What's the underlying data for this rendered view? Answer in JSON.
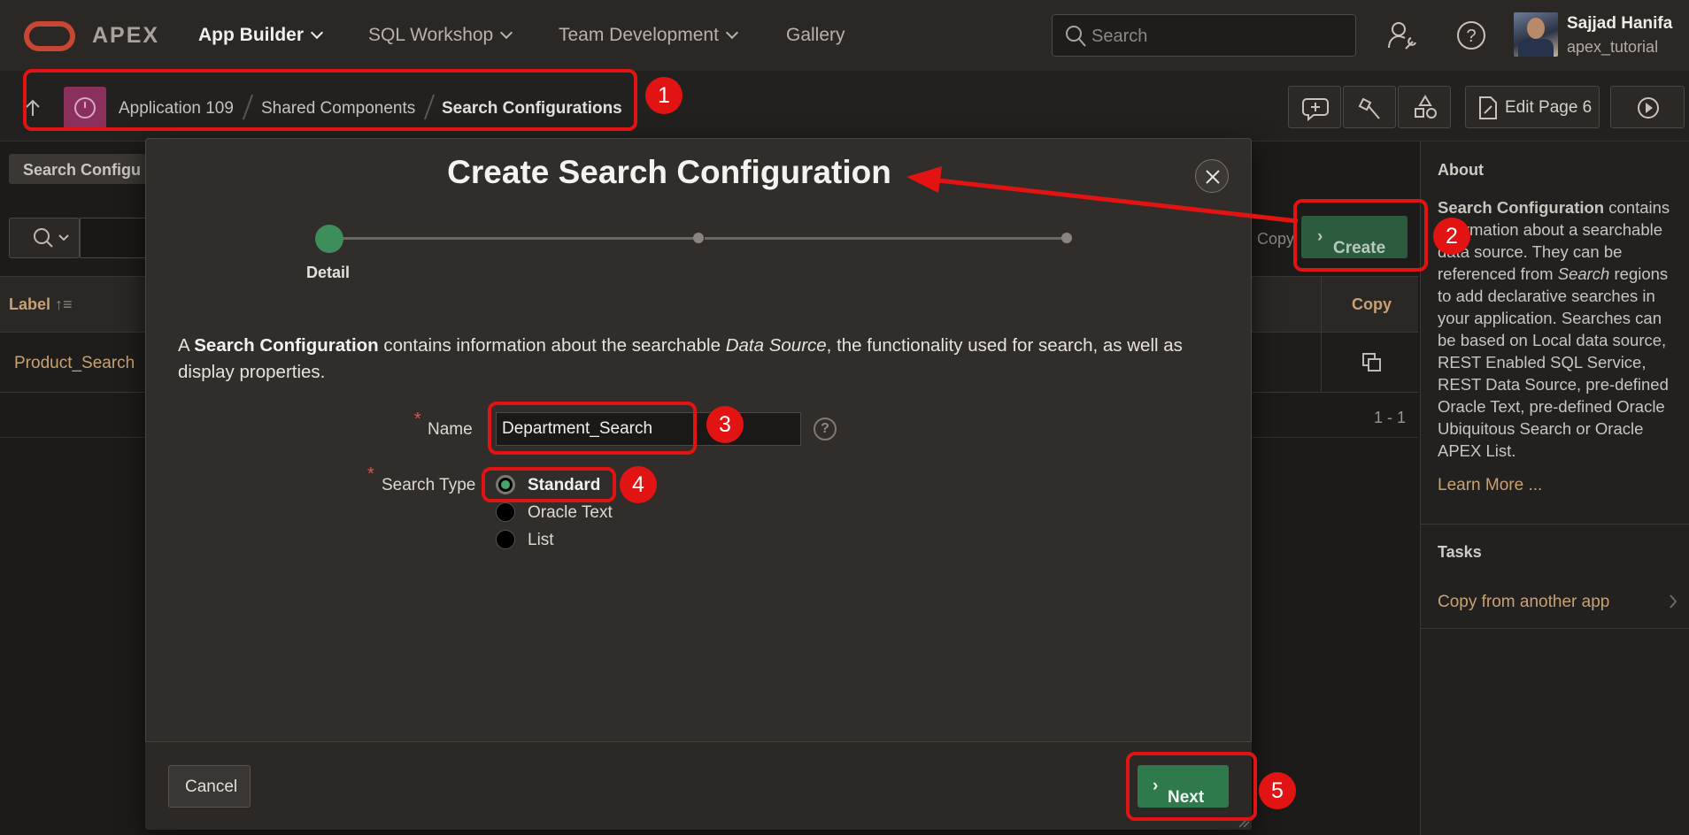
{
  "topbar": {
    "brand": "APEX",
    "nav": [
      {
        "label": "App Builder",
        "active": true
      },
      {
        "label": "SQL Workshop",
        "active": false
      },
      {
        "label": "Team Development",
        "active": false
      },
      {
        "label": "Gallery",
        "active": false
      }
    ],
    "search_placeholder": "Search",
    "user": {
      "name": "Sajjad Hanifa",
      "workspace": "apex_tutorial"
    }
  },
  "breadcrumb": {
    "items": [
      "Application 109",
      "Shared Components",
      "Search Configurations"
    ]
  },
  "toolbar": {
    "edit_page_label": "Edit Page 6"
  },
  "background_page": {
    "region_tab": "Search Configu",
    "copy_button": "Copy",
    "create_button": "Create",
    "columns": {
      "label": "Label",
      "copy": "Copy"
    },
    "rows": [
      {
        "label": "Product_Search"
      }
    ],
    "pagination": "1 - 1"
  },
  "side_panel": {
    "about_title": "About",
    "about_bold": "Search Configuration",
    "about_text_1": " contains information about a searchable data source. They can be referenced from ",
    "about_italic": "Search",
    "about_text_2": " regions to add declarative searches in your application. Searches can be based on Local data source, REST Enabled SQL Service, REST Data Source, pre-defined Oracle Text, pre-defined Oracle Ubiquitous Search or Oracle APEX List.",
    "learn_more": "Learn More ...",
    "tasks_title": "Tasks",
    "task_link": "Copy from another app"
  },
  "dialog": {
    "title": "Create Search Configuration",
    "wizard_step_label": "Detail",
    "intro": {
      "prefix": "A ",
      "bold": "Search Configuration",
      "middle": " contains information about the searchable ",
      "italic": "Data Source",
      "suffix": ", the functionality used for search, as well as display properties."
    },
    "name_label": "Name",
    "name_value": "Department_Search",
    "search_type_label": "Search Type",
    "search_type_options": [
      "Standard",
      "Oracle Text",
      "List"
    ],
    "search_type_selected": "Standard",
    "cancel_label": "Cancel",
    "next_label": "Next"
  },
  "annotations": [
    "1",
    "2",
    "3",
    "4",
    "5"
  ],
  "colors": {
    "annotation_red": "#e21313",
    "primary_green": "#2f7a4d",
    "link_gold": "#c7a274",
    "oracle_red": "#c74634"
  }
}
